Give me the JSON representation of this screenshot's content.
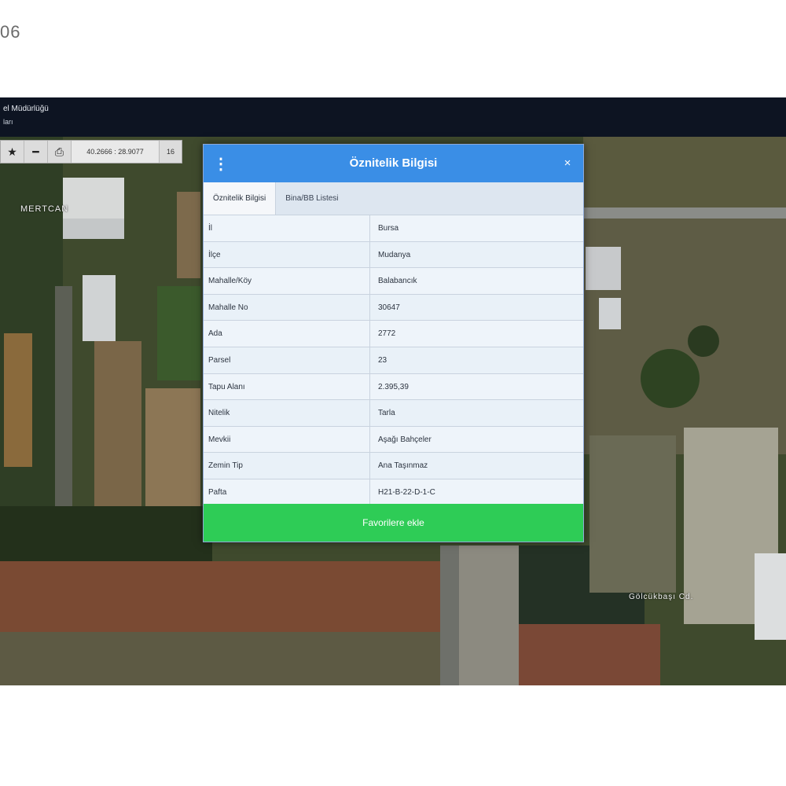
{
  "corner_text": "06",
  "app": {
    "title_line1": "el Müdürlüğü",
    "title_line2": "ları"
  },
  "toolbar": {
    "star_icon": "star-icon",
    "minus_icon": "minus-icon",
    "print_icon": "print-icon",
    "coordinates": "40.2666 : 28.9077",
    "zoom": "16"
  },
  "map": {
    "label_site": "MERTCAN",
    "label_road": "Gölcükbaşı Cd."
  },
  "dialog": {
    "title": "Öznitelik Bilgisi",
    "menu_icon": "kebab-menu-icon",
    "close_icon": "close-icon",
    "close_glyph": "×",
    "tabs": [
      {
        "label": "Öznitelik Bilgisi",
        "active": true
      },
      {
        "label": "Bina/BB Listesi",
        "active": false
      }
    ],
    "rows": [
      {
        "key": "İl",
        "value": "Bursa"
      },
      {
        "key": "İlçe",
        "value": "Mudanya"
      },
      {
        "key": "Mahalle/Köy",
        "value": "Balabancık"
      },
      {
        "key": "Mahalle No",
        "value": "30647"
      },
      {
        "key": "Ada",
        "value": "2772"
      },
      {
        "key": "Parsel",
        "value": "23"
      },
      {
        "key": "Tapu Alanı",
        "value": "2.395,39"
      },
      {
        "key": "Nitelik",
        "value": "Tarla"
      },
      {
        "key": "Mevkii",
        "value": "Aşağı Bahçeler"
      },
      {
        "key": "Zemin Tip",
        "value": "Ana Taşınmaz"
      },
      {
        "key": "Pafta",
        "value": "H21-B-22-D-1-C"
      }
    ],
    "favorite_button": "Favorilere ekle"
  },
  "colors": {
    "header_blue": "#3a8ee6",
    "button_green": "#2ecc56",
    "topbar_navy": "#0d1422"
  }
}
